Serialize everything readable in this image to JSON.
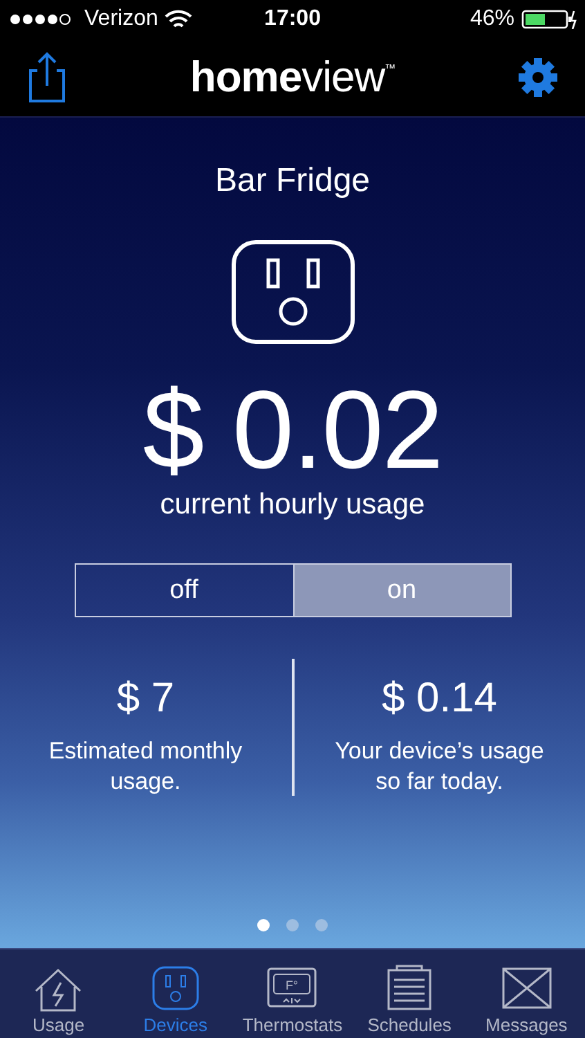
{
  "status_bar": {
    "carrier": "Verizon",
    "time": "17:00",
    "battery": "46%"
  },
  "nav_bar": {
    "logo": "**home**view$^{™}$"
  },
  "device": {
    "name": "Bar Fridge",
    "cost": "$ 0.02",
    "cost_label": "current hourly usage"
  },
  "toggle": [
    {
      "label": "off",
      "selected": false
    },
    {
      "label": "on",
      "selected": true
    }
  ],
  "stats": [
    {
      "value": "$ 7",
      "label": "Estimated monthly usage."
    },
    {
      "value": "$ 0.14",
      "label": "Your device’s usage so far today."
    }
  ],
  "pages": [
    {
      "selected": true
    },
    {
      "selected": false
    },
    {
      "selected": false
    }
  ],
  "tabs": [
    {
      "kind": "house",
      "label": "Usage",
      "selected": false
    },
    {
      "kind": "outlet",
      "label": "Devices",
      "selected": true
    },
    {
      "kind": "thermostat",
      "label": "Thermostats",
      "selected": false,
      "icon_text": "F°"
    },
    {
      "kind": "schedule",
      "label": "Schedules",
      "selected": false
    },
    {
      "kind": "mail",
      "label": "Messages",
      "selected": false
    }
  ]
}
